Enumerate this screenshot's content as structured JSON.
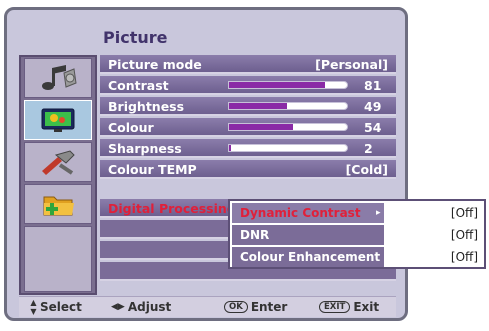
{
  "title": "Picture",
  "sidebar": [
    {
      "icon": "music-note-icon"
    },
    {
      "icon": "tv-screen-icon",
      "active": true
    },
    {
      "icon": "tools-icon"
    },
    {
      "icon": "folder-icon"
    },
    {
      "icon": "empty"
    }
  ],
  "menu": {
    "picture_mode": {
      "label": "Picture mode",
      "value": "[Personal]"
    },
    "contrast": {
      "label": "Contrast",
      "value": 81
    },
    "brightness": {
      "label": "Brightness",
      "value": 49
    },
    "colour": {
      "label": "Colour",
      "value": 54
    },
    "sharpness": {
      "label": "Sharpness",
      "value": 2
    },
    "colour_temp": {
      "label": "Colour TEMP",
      "value": "[Cold]"
    },
    "digital_processing": {
      "label": "Digital Processing"
    }
  },
  "submenu": {
    "dynamic_contrast": {
      "label": "Dynamic Contrast",
      "arrow": "▸",
      "value": "[Off]"
    },
    "dnr": {
      "label": "DNR",
      "value": "[Off]"
    },
    "colour_enhancement": {
      "label": "Colour  Enhancement",
      "value": "[Off]"
    }
  },
  "footer": {
    "select": {
      "glyph": "▲▼",
      "label": "Select"
    },
    "adjust": {
      "glyph": "◀▶",
      "label": "Adjust"
    },
    "enter": {
      "pill": "OK",
      "label": "Enter"
    },
    "exit": {
      "pill": "EXIT",
      "label": "Exit"
    }
  },
  "colors": {
    "bar_fill": "#8a2aa6",
    "highlight_text": "#e0203a",
    "row_bg": "#7b6c98"
  }
}
